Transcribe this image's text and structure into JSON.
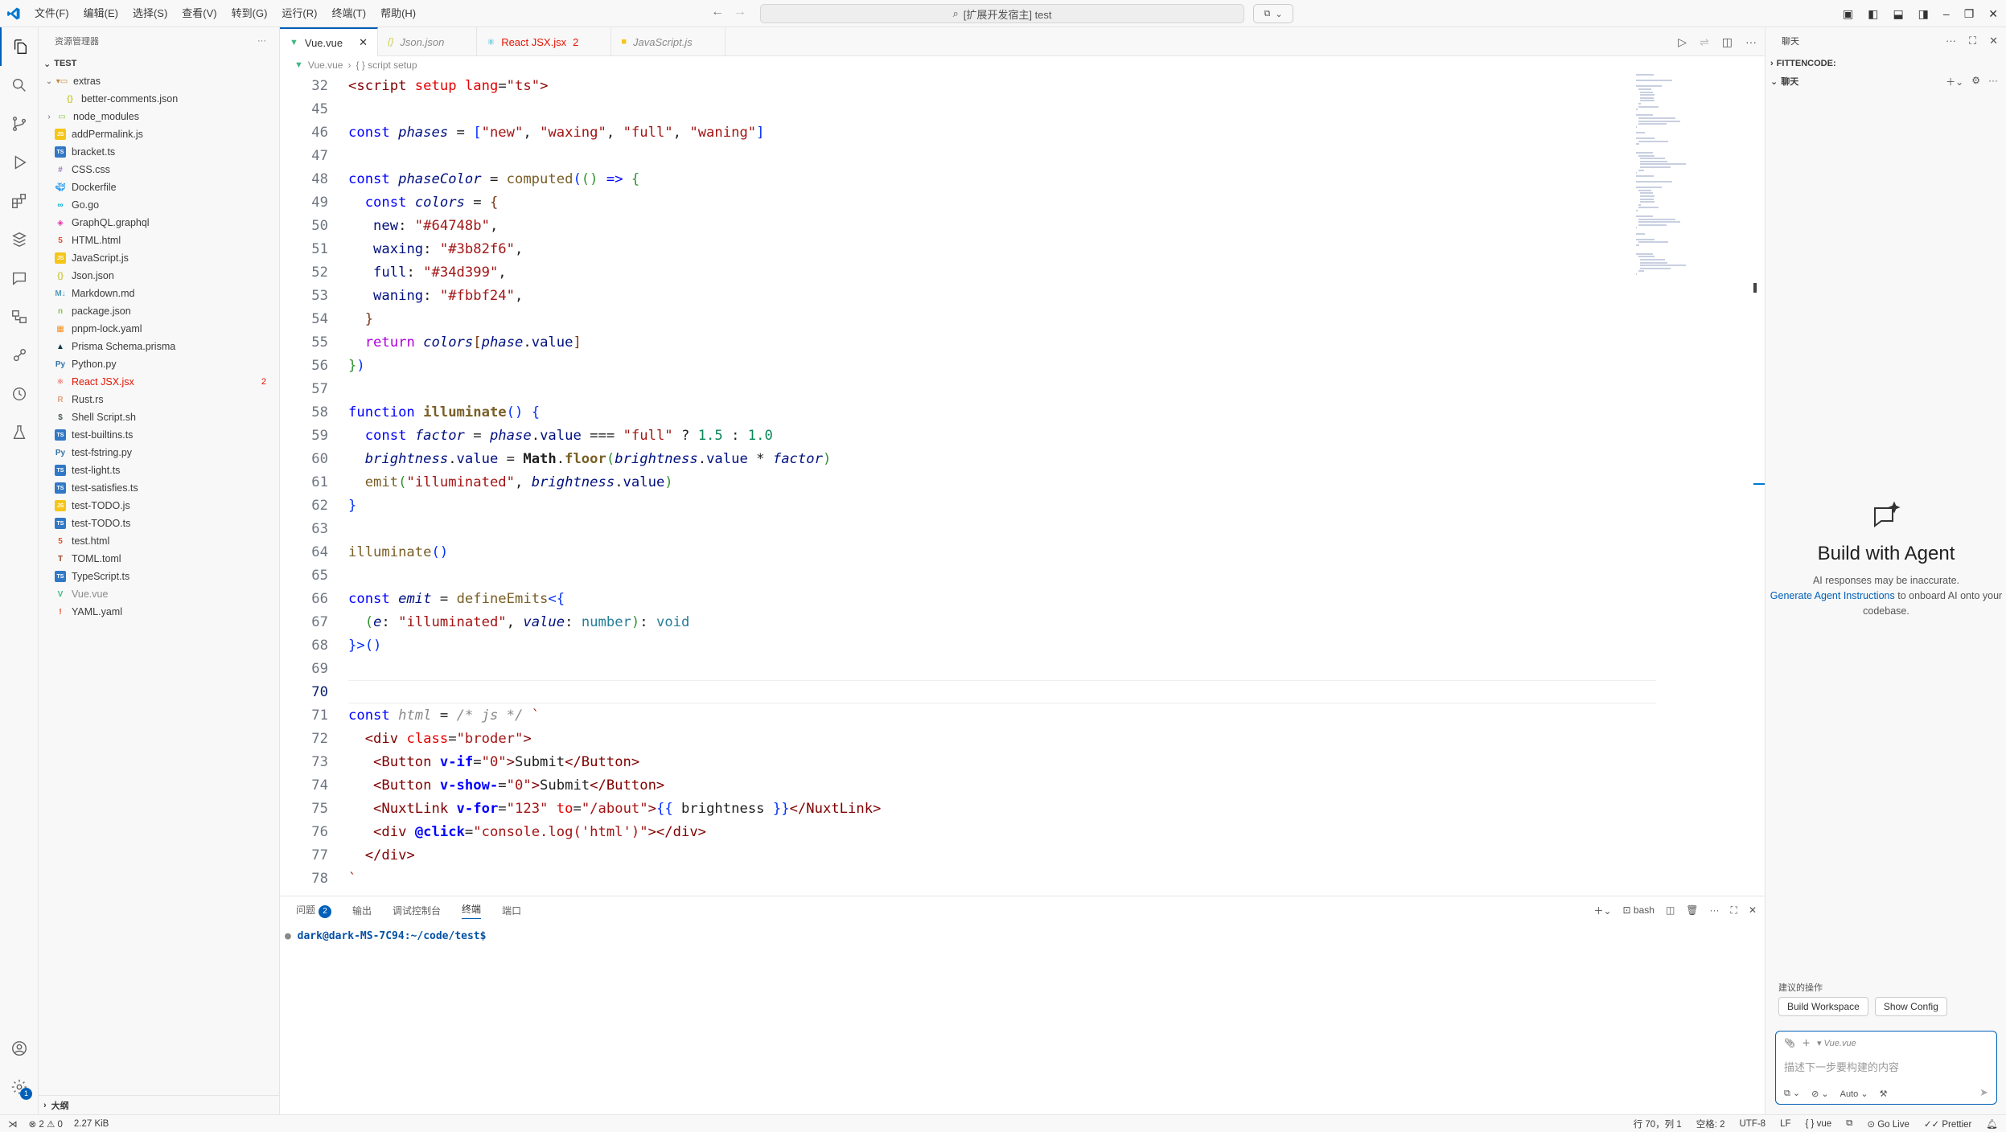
{
  "menu": [
    "文件(F)",
    "编辑(E)",
    "选择(S)",
    "查看(V)",
    "转到(G)",
    "运行(R)",
    "终端(T)",
    "帮助(H)"
  ],
  "command_center": {
    "text": "[扩展开发宿主] test"
  },
  "sidebar": {
    "title": "资源管理器",
    "root": "TEST",
    "items": [
      {
        "label": "extras",
        "type": "folder-open",
        "color": "#c08a3e"
      },
      {
        "label": "better-comments.json",
        "type": "json",
        "color": "#cbcb41"
      },
      {
        "label": "node_modules",
        "type": "folder",
        "color": "#8bc34a"
      },
      {
        "label": "addPermalink.js",
        "type": "js",
        "color": "#f5c518"
      },
      {
        "label": "bracket.ts",
        "type": "ts",
        "color": "#3178c6"
      },
      {
        "label": "CSS.css",
        "type": "css",
        "color": "#a074c4"
      },
      {
        "label": "Dockerfile",
        "type": "docker",
        "color": "#2496ed"
      },
      {
        "label": "Go.go",
        "type": "go",
        "color": "#00add8"
      },
      {
        "label": "GraphQL.graphql",
        "type": "graphql",
        "color": "#e535ab"
      },
      {
        "label": "HTML.html",
        "type": "html",
        "color": "#e44d26"
      },
      {
        "label": "JavaScript.js",
        "type": "js",
        "color": "#f5c518"
      },
      {
        "label": "Json.json",
        "type": "json",
        "color": "#cbcb41"
      },
      {
        "label": "Markdown.md",
        "type": "md",
        "color": "#519aba"
      },
      {
        "label": "package.json",
        "type": "npm",
        "color": "#8bc34a"
      },
      {
        "label": "pnpm-lock.yaml",
        "type": "pnpm",
        "color": "#f69220"
      },
      {
        "label": "Prisma Schema.prisma",
        "type": "prisma",
        "color": "#0c344b"
      },
      {
        "label": "Python.py",
        "type": "py",
        "color": "#3572a5"
      },
      {
        "label": "React JSX.jsx",
        "type": "react",
        "color": "#e51400",
        "badge": "2"
      },
      {
        "label": "Rust.rs",
        "type": "rs",
        "color": "#dea584"
      },
      {
        "label": "Shell Script.sh",
        "type": "sh",
        "color": "#4d5a5e"
      },
      {
        "label": "test-builtins.ts",
        "type": "ts",
        "color": "#3178c6"
      },
      {
        "label": "test-fstring.py",
        "type": "py",
        "color": "#3572a5"
      },
      {
        "label": "test-light.ts",
        "type": "ts",
        "color": "#3178c6"
      },
      {
        "label": "test-satisfies.ts",
        "type": "ts",
        "color": "#3178c6"
      },
      {
        "label": "test-TODO.js",
        "type": "js",
        "color": "#f5c518"
      },
      {
        "label": "test-TODO.ts",
        "type": "ts",
        "color": "#3178c6"
      },
      {
        "label": "test.html",
        "type": "html",
        "color": "#e44d26"
      },
      {
        "label": "TOML.toml",
        "type": "toml",
        "color": "#9c4221"
      },
      {
        "label": "TypeScript.ts",
        "type": "ts",
        "color": "#3178c6"
      },
      {
        "label": "Vue.vue",
        "type": "vue",
        "color": "#41b883"
      },
      {
        "label": "YAML.yaml",
        "type": "yaml",
        "color": "#e44d26"
      }
    ],
    "outline": "大纲"
  },
  "tabs": [
    {
      "label": "Vue.vue",
      "state": "active"
    },
    {
      "label": "Json.json",
      "state": "preview"
    },
    {
      "label": "React JSX.jsx",
      "state": "error",
      "badge": "2"
    },
    {
      "label": "JavaScript.js",
      "state": "preview"
    }
  ],
  "breadcrumb": [
    "Vue.vue",
    "{ } script setup"
  ],
  "code": [
    {
      "n": "32",
      "html": "<span class='tag'>&lt;script</span> <span class='attr'>setup</span> <span class='attr'>lang</span>=<span class='str'>\"ts\"</span><span class='tag'>&gt;</span>"
    },
    {
      "n": "45",
      "html": ""
    },
    {
      "n": "46",
      "html": "<span class='kw'>const</span> <span class='var'>phases</span> = <span class='br1'>[</span><span class='str'>\"new\"</span>, <span class='str'>\"waxing\"</span>, <span class='str'>\"full\"</span>, <span class='str'>\"waning\"</span><span class='br1'>]</span>"
    },
    {
      "n": "47",
      "html": ""
    },
    {
      "n": "48",
      "html": "<span class='kw'>const</span> <span class='var'>phaseColor</span> = <span class='fn'>computed</span><span class='br1'>(</span><span class='br2'>()</span> <span class='kw'>=&gt;</span> <span class='br2'>{</span>"
    },
    {
      "n": "49",
      "html": "  <span class='kw'>const</span> <span class='var'>colors</span> = <span class='br3'>{</span>"
    },
    {
      "n": "50",
      "html": "   <span class='prop'>new</span>: <span class='str'>\"#64748b\"</span>,"
    },
    {
      "n": "51",
      "html": "   <span class='prop'>waxing</span>: <span class='str'>\"#3b82f6\"</span>,"
    },
    {
      "n": "52",
      "html": "   <span class='prop'>full</span>: <span class='str'>\"#34d399\"</span>,"
    },
    {
      "n": "53",
      "html": "   <span class='prop'>waning</span>: <span class='str'>\"#fbbf24\"</span>,"
    },
    {
      "n": "54",
      "html": "  <span class='br3'>}</span>"
    },
    {
      "n": "55",
      "html": "  <span class='kw2'>return</span> <span class='var'>colors</span><span class='br3'>[</span><span class='var'>phase</span>.<span class='prop'>value</span><span class='br3'>]</span>"
    },
    {
      "n": "56",
      "html": "<span class='br2'>}</span><span class='br1'>)</span>"
    },
    {
      "n": "57",
      "html": ""
    },
    {
      "n": "58",
      "html": "<span class='kw'>function</span> <span class='fn bold'>illuminate</span><span class='br1'>()</span> <span class='br1'>{</span>"
    },
    {
      "n": "59",
      "html": "  <span class='kw'>const</span> <span class='var'>factor</span> = <span class='var'>phase</span>.<span class='prop'>value</span> === <span class='str'>\"full\"</span> ? <span class='num'>1.5</span> : <span class='num'>1.0</span>"
    },
    {
      "n": "60",
      "html": "  <span class='var'>brightness</span>.<span class='prop'>value</span> = <span class='bold'>Math</span>.<span class='fn bold'>floor</span><span class='br2'>(</span><span class='var'>brightness</span>.<span class='prop'>value</span> * <span class='var'>factor</span><span class='br2'>)</span>"
    },
    {
      "n": "61",
      "html": "  <span class='fn'>emit</span><span class='br2'>(</span><span class='str'>\"illuminated\"</span>, <span class='var'>brightness</span>.<span class='prop'>value</span><span class='br2'>)</span>"
    },
    {
      "n": "62",
      "html": "<span class='br1'>}</span>"
    },
    {
      "n": "63",
      "html": ""
    },
    {
      "n": "64",
      "html": "<span class='fn'>illuminate</span><span class='br1'>()</span>"
    },
    {
      "n": "65",
      "html": ""
    },
    {
      "n": "66",
      "html": "<span class='kw'>const</span> <span class='var'>emit</span> = <span class='fn'>defineEmits</span><span class='br1'>&lt;{</span>"
    },
    {
      "n": "67",
      "html": "  <span class='br2'>(</span><span class='var'>e</span>: <span class='str'>\"illuminated\"</span>, <span class='var'>value</span>: <span class='ty'>number</span><span class='br2'>)</span>: <span class='ty'>void</span>"
    },
    {
      "n": "68",
      "html": "<span class='br1'>}&gt;</span><span class='br1'>()</span>"
    },
    {
      "n": "69",
      "html": ""
    },
    {
      "n": "70",
      "html": "",
      "current": true
    },
    {
      "n": "71",
      "html": "<span class='kw'>const</span> <span class='cm'>html</span> = <span class='cm'>/* js */</span> <span class='str'>`</span>"
    },
    {
      "n": "72",
      "html": "  <span class='tag'>&lt;div</span> <span class='attr'>class</span>=<span class='str'>\"broder\"</span><span class='tag'>&gt;</span>"
    },
    {
      "n": "73",
      "html": "   <span class='tag'>&lt;Button</span> <span class='kw bold'>v-if</span>=<span class='str'>\"0\"</span><span class='tag'>&gt;</span>Submit<span class='tag'>&lt;/Button&gt;</span>"
    },
    {
      "n": "74",
      "html": "   <span class='tag'>&lt;Button</span> <span class='kw bold'>v-show-</span>=<span class='str'>\"0\"</span><span class='tag'>&gt;</span>Submit<span class='tag'>&lt;/Button&gt;</span>"
    },
    {
      "n": "75",
      "html": "   <span class='tag'>&lt;NuxtLink</span> <span class='kw bold'>v-for</span>=<span class='str'>\"123\"</span> <span class='attr'>to</span>=<span class='str'>\"/about\"</span><span class='tag'>&gt;</span><span class='br1'>{{</span> brightness <span class='br1'>}}</span><span class='tag'>&lt;/NuxtLink&gt;</span>"
    },
    {
      "n": "76",
      "html": "   <span class='tag'>&lt;div</span> <span class='kw bold'>@click</span>=<span class='str'>\"console.log('html')\"</span><span class='tag'>&gt;&lt;/div&gt;</span>"
    },
    {
      "n": "77",
      "html": "  <span class='tag'>&lt;/div&gt;</span>"
    },
    {
      "n": "78",
      "html": "<span class='str'>`</span>"
    }
  ],
  "panel": {
    "tabs": [
      {
        "label": "问题",
        "count": "2"
      },
      {
        "label": "输出"
      },
      {
        "label": "调试控制台"
      },
      {
        "label": "终端",
        "active": true
      },
      {
        "label": "端口"
      }
    ],
    "shell": "bash",
    "prompt": "dark@dark-MS-7C94:~/code/test$"
  },
  "chat": {
    "title": "聊天",
    "section1": "FITTENCODE:",
    "section2": "聊天",
    "heading": "Build with Agent",
    "note": "AI responses may be inaccurate.",
    "link": "Generate Agent Instructions",
    "link_after": "to onboard AI onto your codebase.",
    "suggest_label": "建议的操作",
    "chips": [
      "Build Workspace",
      "Show Config"
    ],
    "context_file": "Vue.vue",
    "placeholder": "描述下一步要构建的内容",
    "mode": "Auto"
  },
  "status": {
    "errors": "2",
    "warnings": "0",
    "size": "2.27 KiB",
    "position": "行 70，列 1",
    "spaces": "空格: 2",
    "encoding": "UTF-8",
    "eol": "LF",
    "language": "vue",
    "golive": "Go Live",
    "prettier": "Prettier",
    "settings_badge": "1"
  }
}
